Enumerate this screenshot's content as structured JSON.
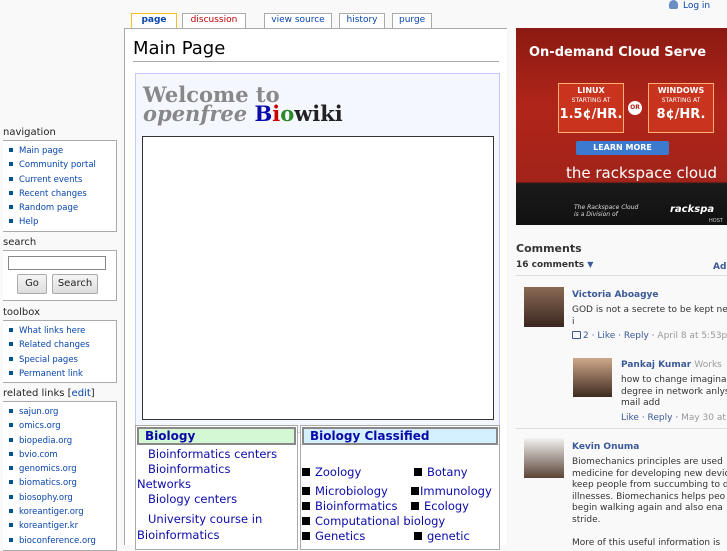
{
  "personal": {
    "login": "Log in"
  },
  "tabs": [
    {
      "label": "page",
      "active": true
    },
    {
      "label": "discussion"
    },
    {
      "label": "view source"
    },
    {
      "label": "history"
    },
    {
      "label": "purge"
    }
  ],
  "page_title": "Main Page",
  "welcome": {
    "line1": "Welcome to",
    "line2_prefix": "openfree",
    "line2_b": "B",
    "line2_i": "i",
    "line2_o": "o",
    "line2_wiki": "wiki"
  },
  "biology": {
    "heading": "Biology",
    "links": [
      "Bioinformatics centers",
      "Bioinformatics",
      "Networks",
      "Biology centers",
      "University course in",
      "Bioinformatics"
    ]
  },
  "biology_classified": {
    "heading": "Biology Classified",
    "rows": [
      [
        "Zoology",
        "Botany"
      ],
      [
        "Microbiology",
        "Immunology"
      ],
      [
        "Bioinformatics",
        "Ecology"
      ],
      [
        "Computational biology"
      ],
      [
        "Genetics",
        "genetic"
      ]
    ]
  },
  "sidebar": {
    "navigation": {
      "heading": "navigation",
      "items": [
        "Main page",
        "Community portal",
        "Current events",
        "Recent changes",
        "Random page",
        "Help"
      ]
    },
    "search": {
      "heading": "search",
      "go": "Go",
      "search": "Search",
      "value": ""
    },
    "toolbox": {
      "heading": "toolbox",
      "items": [
        "What links here",
        "Related changes",
        "Special pages",
        "Permanent link"
      ]
    },
    "related": {
      "heading": "related links",
      "edit": "edit",
      "items": [
        "sajun.org",
        "omics.org",
        "biopedia.org",
        "bvio.com",
        "genomics.org",
        "biomatics.org",
        "biosophy.org",
        "koreantiger.org",
        "koreantiger.kr",
        "bioconference.org"
      ]
    }
  },
  "ad": {
    "title": "On-demand Cloud Serve",
    "linux": {
      "label": "LINUX",
      "starting": "STARTING AT",
      "price": "1.5¢/HR."
    },
    "windows": {
      "label": "WINDOWS",
      "starting": "STARTING AT",
      "price": "8¢/HR."
    },
    "or": "OR",
    "learn_more": "LEARN MORE",
    "logo": "the rackspace cloud",
    "small1": "The Rackspace Cloud",
    "small2": "is a Division of",
    "logo2": "rackspa",
    "hosting": "HOST"
  },
  "comments": {
    "heading": "Comments",
    "count": "16 comments",
    "add": "Ad",
    "items": [
      {
        "name": "Victoria Aboagye",
        "work": "",
        "lines": [
          "GOD is not a secrete to be kept ne",
          "i"
        ],
        "likes": "2",
        "like": "Like",
        "reply": "Reply",
        "date": "April 8 at 5:53p"
      },
      {
        "name": "Pankaj Kumar",
        "work": "Works",
        "lines": [
          "how to change imagina",
          "degree in network anlys",
          "mail add"
        ],
        "like": "Like",
        "reply": "Reply",
        "date": "May 30 at"
      },
      {
        "name": "Kevin Onuma",
        "work": "",
        "lines": [
          "Biomechanics principles are used",
          "medicine for developing new devic",
          "keep people from succumbing to d",
          "illnesses. Biomechanics helps peo",
          "begin walking again and also ena",
          "stride.",
          "",
          "More of this useful information is"
        ]
      }
    ]
  }
}
